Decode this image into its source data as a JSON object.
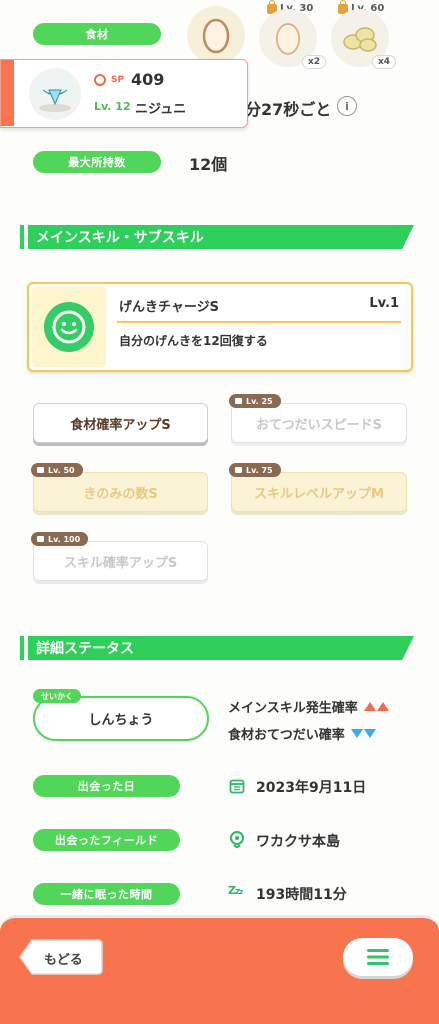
{
  "ingredients": {
    "label": "食材",
    "items": [
      {
        "icon": "egg-icon",
        "lv": "",
        "mult": ""
      },
      {
        "icon": "egg-icon",
        "lv": "Lv. 30",
        "mult": "x2"
      },
      {
        "icon": "soybeans-icon",
        "lv": "Lv. 60",
        "mult": "x4"
      }
    ]
  },
  "pokemon_card": {
    "sp_label": "SP",
    "sp_value": "409",
    "level": "Lv. 12",
    "name": "ニジュニ"
  },
  "help_interval": {
    "value": "分27秒ごと",
    "info_icon": "info-icon"
  },
  "max_carry": {
    "label": "最大所持数",
    "value": "12個"
  },
  "skills_section": {
    "title": "メインスキル・サブスキル",
    "main_skill": {
      "name": "げんきチャージS",
      "level": "Lv.1",
      "description": "自分のげんきを12回復する",
      "icon": "smiley-icon"
    },
    "sub_skills": [
      {
        "label": "食材確率アップS",
        "lv": "",
        "state": "active"
      },
      {
        "label": "おてつだいスピードS",
        "lv": "Lv. 25",
        "state": "locked"
      },
      {
        "label": "きのみの数S",
        "lv": "Lv. 50",
        "state": "gold"
      },
      {
        "label": "スキルレベルアップM",
        "lv": "Lv. 75",
        "state": "gold"
      },
      {
        "label": "スキル確率アップS",
        "lv": "Lv. 100",
        "state": "locked"
      }
    ]
  },
  "details_section": {
    "title": "詳細ステータス",
    "nature_tag": "せいかく",
    "nature": "しんちょう",
    "effect_up": "メインスキル発生確率",
    "effect_down": "食材おてつだい確率",
    "met_date_label": "出会った日",
    "met_date": "2023年9月11日",
    "met_field_label": "出会ったフィールド",
    "met_field": "ワカクサ本島",
    "sleep_time_label": "一緒に眠った時間",
    "sleep_time": "193時間11分"
  },
  "footer": {
    "back_label": "もどる",
    "menu_icon": "hamburger-menu-icon"
  },
  "colors": {
    "accent_green": "#52d65a",
    "footer_orange": "#f8744f",
    "card_gold": "#f3c94e"
  }
}
